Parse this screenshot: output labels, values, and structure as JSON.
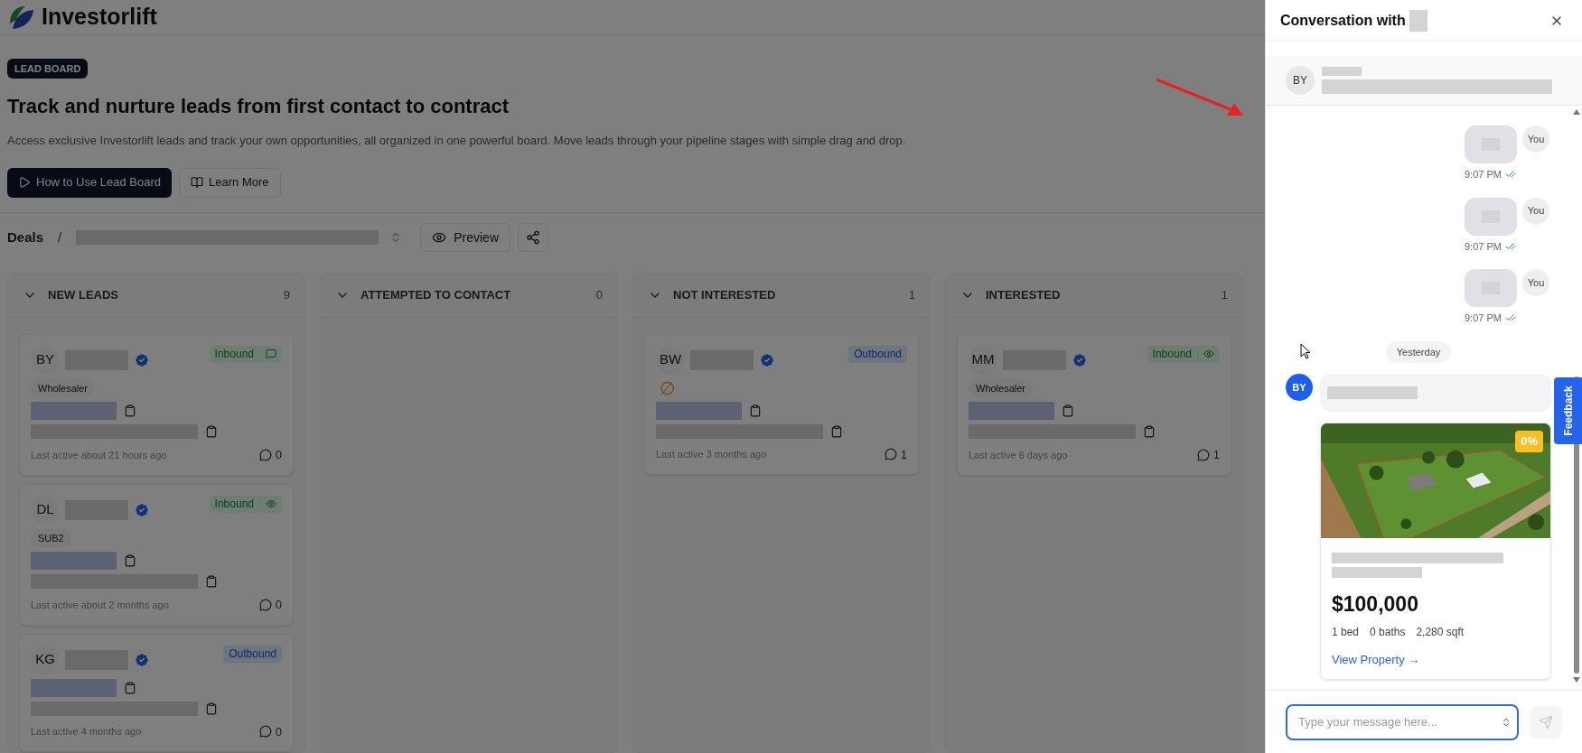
{
  "header": {
    "brand": "Investorlift"
  },
  "hero": {
    "badge": "LEAD BOARD",
    "title": "Track and nurture leads from first contact to contract",
    "description": "Access exclusive Investorlift leads and track your own opportunities, all organized in one powerful board. Move leads through your pipeline stages with simple drag and drop.",
    "buttons": [
      {
        "label": "How to Use Lead Board",
        "kind": "primary"
      },
      {
        "label": "Learn More",
        "kind": "secondary"
      }
    ]
  },
  "deals_bar": {
    "label": "Deals",
    "separator": "/",
    "preview_button": "Preview"
  },
  "columns": [
    {
      "title": "NEW LEADS",
      "count": "9",
      "expanded": true,
      "cards": [
        {
          "initials": "BY",
          "verified": true,
          "source": {
            "label": "Inbound",
            "kind": "inbound",
            "messaged": true
          },
          "tag": "Wholesaler",
          "last_active": "Last active about 21 hours ago",
          "comments": "0"
        },
        {
          "initials": "DL",
          "verified": true,
          "source": {
            "label": "Inbound",
            "kind": "inbound",
            "viewed": true
          },
          "tag": "SUB2",
          "last_active": "Last active about 2 months ago",
          "comments": "0"
        },
        {
          "initials": "KG",
          "verified": true,
          "source": {
            "label": "Outbound",
            "kind": "outbound"
          },
          "last_active": "Last active 4 months ago",
          "comments": "0"
        }
      ]
    },
    {
      "title": "ATTEMPTED TO CONTACT",
      "count": "0",
      "expanded": true
    },
    {
      "title": "NOT INTERESTED",
      "count": "1",
      "expanded": true,
      "cards": [
        {
          "initials": "BW",
          "verified": true,
          "source": {
            "label": "Outbound",
            "kind": "outbound"
          },
          "status_symbol": "∅",
          "last_active": "Last active 3 months ago",
          "comments": "1"
        }
      ]
    },
    {
      "title": "INTERESTED",
      "count": "1",
      "expanded": true,
      "cards": [
        {
          "initials": "MM",
          "verified": true,
          "source": {
            "label": "Inbound",
            "kind": "inbound",
            "viewed": true
          },
          "tag": "Wholesaler",
          "last_active": "Last active 6 days ago",
          "comments": "1"
        }
      ]
    }
  ],
  "conversation": {
    "title": "Conversation with",
    "contact_initials": "BY",
    "messages": [
      {
        "kind": "outgoing",
        "avatar": "You",
        "time": "9:07 PM",
        "read": true
      },
      {
        "kind": "outgoing",
        "avatar": "You",
        "time": "9:07 PM",
        "read": true
      },
      {
        "kind": "outgoing",
        "avatar": "You",
        "time": "9:07 PM",
        "read": true
      },
      {
        "kind": "divider",
        "label": "Yesterday"
      },
      {
        "kind": "incoming",
        "avatar": "BY",
        "property": {
          "badge": "0%",
          "price": "$100,000",
          "beds": "1 bed",
          "baths": "0 baths",
          "area": "2,280 sqft",
          "link": "View Property →"
        }
      }
    ],
    "input": {
      "placeholder": "Type your message here..."
    },
    "send_disabled": true
  },
  "feedback_tab": "Feedback"
}
